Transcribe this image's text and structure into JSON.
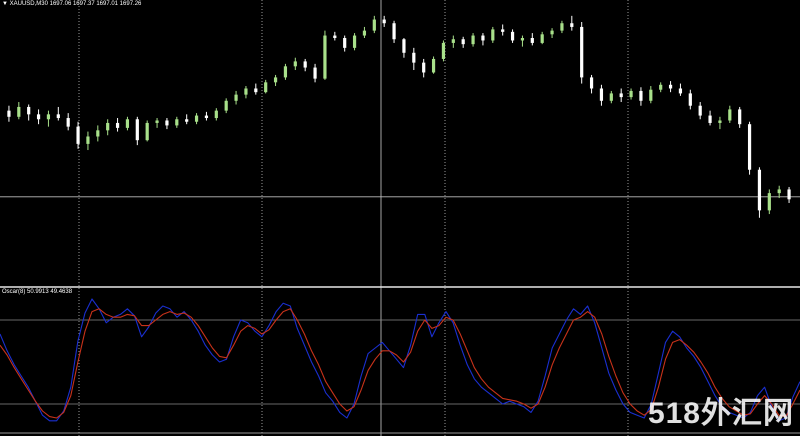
{
  "chart_data": [
    {
      "type": "candlestick",
      "symbol_header": "▼ XAUUSD,M30  1697.06 1697.37 1697.01 1697.26",
      "y_range": [
        1660,
        1705
      ],
      "horizontal_line": 1674,
      "bull_color": "#a8e08a",
      "bear_color": "#ffffff",
      "candles": [
        [
          1688.0,
          1688.8,
          1686.2,
          1687.0
        ],
        [
          1687.0,
          1689.4,
          1686.6,
          1688.6
        ],
        [
          1688.6,
          1689.0,
          1686.4,
          1687.4
        ],
        [
          1687.4,
          1688.2,
          1685.8,
          1686.6
        ],
        [
          1686.6,
          1688.0,
          1685.4,
          1687.4
        ],
        [
          1687.4,
          1688.6,
          1686.4,
          1686.8
        ],
        [
          1686.8,
          1687.6,
          1684.8,
          1685.4
        ],
        [
          1685.4,
          1686.2,
          1681.8,
          1682.6
        ],
        [
          1682.6,
          1684.6,
          1681.6,
          1683.8
        ],
        [
          1683.8,
          1685.6,
          1683.0,
          1684.8
        ],
        [
          1684.8,
          1686.6,
          1684.0,
          1686.0
        ],
        [
          1686.0,
          1686.8,
          1684.6,
          1685.2
        ],
        [
          1685.2,
          1687.0,
          1684.8,
          1686.6
        ],
        [
          1686.6,
          1687.0,
          1682.4,
          1683.2
        ],
        [
          1683.2,
          1686.4,
          1683.0,
          1686.0
        ],
        [
          1686.0,
          1686.8,
          1685.2,
          1686.4
        ],
        [
          1686.4,
          1686.8,
          1685.0,
          1685.6
        ],
        [
          1685.6,
          1687.0,
          1685.2,
          1686.6
        ],
        [
          1686.6,
          1687.4,
          1685.8,
          1686.2
        ],
        [
          1686.2,
          1687.6,
          1685.8,
          1687.2
        ],
        [
          1687.2,
          1687.8,
          1686.4,
          1686.8
        ],
        [
          1686.8,
          1688.4,
          1686.4,
          1688.0
        ],
        [
          1688.0,
          1690.0,
          1687.6,
          1689.6
        ],
        [
          1689.6,
          1691.2,
          1689.0,
          1690.6
        ],
        [
          1690.6,
          1692.0,
          1690.0,
          1691.6
        ],
        [
          1691.6,
          1692.4,
          1690.6,
          1691.0
        ],
        [
          1691.0,
          1693.0,
          1690.8,
          1692.6
        ],
        [
          1692.6,
          1693.8,
          1692.0,
          1693.4
        ],
        [
          1693.4,
          1695.6,
          1693.0,
          1695.2
        ],
        [
          1695.2,
          1696.6,
          1694.6,
          1696.0
        ],
        [
          1696.0,
          1696.4,
          1694.4,
          1695.0
        ],
        [
          1695.0,
          1695.6,
          1692.6,
          1693.2
        ],
        [
          1693.2,
          1701.0,
          1693.0,
          1700.2
        ],
        [
          1700.2,
          1700.8,
          1699.4,
          1699.8
        ],
        [
          1699.8,
          1700.2,
          1697.6,
          1698.2
        ],
        [
          1698.2,
          1700.6,
          1697.8,
          1700.2
        ],
        [
          1700.2,
          1701.6,
          1699.8,
          1701.0
        ],
        [
          1701.0,
          1703.4,
          1700.6,
          1702.8
        ],
        [
          1702.8,
          1703.4,
          1701.6,
          1702.2
        ],
        [
          1702.2,
          1702.6,
          1699.0,
          1699.6
        ],
        [
          1699.6,
          1699.8,
          1696.6,
          1697.4
        ],
        [
          1697.4,
          1698.2,
          1694.6,
          1695.8
        ],
        [
          1695.8,
          1696.4,
          1693.4,
          1694.2
        ],
        [
          1694.2,
          1696.8,
          1694.0,
          1696.4
        ],
        [
          1696.4,
          1699.4,
          1696.0,
          1699.0
        ],
        [
          1699.0,
          1700.2,
          1698.2,
          1699.6
        ],
        [
          1699.6,
          1700.0,
          1698.2,
          1698.8
        ],
        [
          1698.8,
          1700.6,
          1698.4,
          1700.2
        ],
        [
          1700.2,
          1700.6,
          1698.6,
          1699.4
        ],
        [
          1699.4,
          1701.6,
          1699.0,
          1701.2
        ],
        [
          1701.2,
          1702.0,
          1700.2,
          1700.8
        ],
        [
          1700.8,
          1701.2,
          1699.0,
          1699.4
        ],
        [
          1699.4,
          1700.2,
          1698.4,
          1699.8
        ],
        [
          1699.8,
          1700.6,
          1698.6,
          1699.0
        ],
        [
          1699.0,
          1700.8,
          1698.8,
          1700.4
        ],
        [
          1700.4,
          1701.4,
          1699.8,
          1701.0
        ],
        [
          1701.0,
          1702.6,
          1700.6,
          1702.2
        ],
        [
          1702.2,
          1703.4,
          1701.0,
          1701.6
        ],
        [
          1701.6,
          1702.4,
          1692.4,
          1693.4
        ],
        [
          1693.4,
          1693.8,
          1690.8,
          1691.6
        ],
        [
          1691.6,
          1692.2,
          1688.8,
          1689.6
        ],
        [
          1689.6,
          1691.2,
          1689.2,
          1690.8
        ],
        [
          1690.8,
          1691.6,
          1689.4,
          1690.2
        ],
        [
          1690.2,
          1691.6,
          1689.8,
          1691.2
        ],
        [
          1691.2,
          1691.8,
          1688.8,
          1689.6
        ],
        [
          1689.6,
          1692.0,
          1689.2,
          1691.4
        ],
        [
          1691.4,
          1692.6,
          1691.0,
          1692.2
        ],
        [
          1692.2,
          1692.8,
          1691.0,
          1691.6
        ],
        [
          1691.6,
          1692.4,
          1690.4,
          1690.8
        ],
        [
          1690.8,
          1691.4,
          1688.2,
          1688.8
        ],
        [
          1688.8,
          1689.4,
          1686.6,
          1687.2
        ],
        [
          1687.2,
          1688.0,
          1685.6,
          1686.0
        ],
        [
          1686.0,
          1687.0,
          1685.0,
          1686.4
        ],
        [
          1686.4,
          1688.8,
          1686.0,
          1688.2
        ],
        [
          1688.2,
          1688.6,
          1685.2,
          1685.8
        ],
        [
          1685.8,
          1686.2,
          1677.6,
          1678.4
        ],
        [
          1678.4,
          1678.8,
          1670.6,
          1671.8
        ],
        [
          1671.8,
          1675.2,
          1671.2,
          1674.6
        ],
        [
          1674.6,
          1675.8,
          1673.8,
          1675.2
        ],
        [
          1675.2,
          1675.6,
          1673.0,
          1673.6
        ]
      ]
    },
    {
      "type": "line",
      "indicator_header": "Oscar(8) 50.9913 49.4638",
      "y_range": [
        0,
        100
      ],
      "levels": [
        80,
        20
      ],
      "series": [
        {
          "color": "#1a2fd0",
          "values": [
            70,
            58,
            48,
            40,
            32,
            22,
            12,
            8,
            8,
            15,
            32,
            65,
            85,
            95,
            88,
            78,
            82,
            84,
            88,
            83,
            68,
            75,
            85,
            90,
            88,
            82,
            86,
            80,
            72,
            62,
            55,
            50,
            52,
            68,
            80,
            78,
            72,
            68,
            76,
            86,
            92,
            90,
            74,
            62,
            50,
            40,
            28,
            22,
            14,
            10,
            20,
            40,
            56,
            60,
            64,
            58,
            52,
            46,
            62,
            84,
            84,
            68,
            78,
            86,
            78,
            62,
            48,
            38,
            32,
            28,
            24,
            20,
            22,
            20,
            18,
            14,
            22,
            40,
            60,
            70,
            80,
            88,
            84,
            90,
            78,
            60,
            42,
            30,
            20,
            14,
            12,
            10,
            20,
            42,
            64,
            72,
            68,
            60,
            54,
            46,
            36,
            26,
            18,
            14,
            12,
            10,
            14,
            26,
            32,
            18,
            8,
            10,
            25,
            36
          ]
        },
        {
          "color": "#c8321a",
          "values": [
            62,
            55,
            46,
            38,
            30,
            22,
            15,
            11,
            10,
            14,
            26,
            50,
            72,
            86,
            88,
            84,
            82,
            82,
            84,
            83,
            76,
            76,
            80,
            84,
            86,
            84,
            85,
            82,
            76,
            68,
            60,
            54,
            53,
            62,
            72,
            76,
            74,
            70,
            73,
            80,
            86,
            88,
            80,
            70,
            58,
            48,
            36,
            28,
            20,
            15,
            18,
            30,
            44,
            52,
            58,
            58,
            55,
            50,
            57,
            72,
            80,
            74,
            76,
            82,
            80,
            70,
            58,
            46,
            38,
            32,
            28,
            24,
            23,
            22,
            20,
            17,
            20,
            32,
            48,
            60,
            70,
            80,
            82,
            86,
            82,
            70,
            54,
            40,
            28,
            20,
            15,
            12,
            16,
            32,
            52,
            64,
            66,
            62,
            57,
            50,
            42,
            32,
            24,
            18,
            15,
            12,
            13,
            20,
            26,
            20,
            12,
            11,
            20,
            30
          ]
        }
      ]
    }
  ],
  "watermark": "518外汇网"
}
